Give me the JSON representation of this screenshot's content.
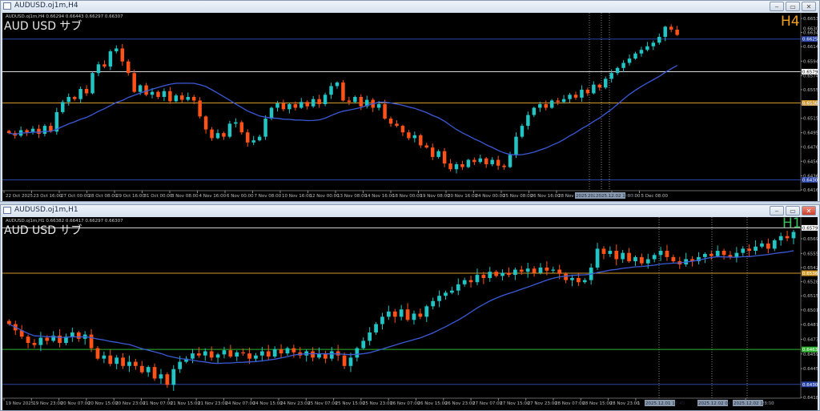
{
  "colors": {
    "bull": "#22c4c4",
    "bear": "#ff5218",
    "ma": "#3a5ad8",
    "axis": "#bfbfbf",
    "white_line": "#d8d8d8",
    "orange_line": "#d39a2a",
    "blue_line": "#2b44a8",
    "green_line": "#2fb52f"
  },
  "windows": [
    {
      "title": "AUDUSD.oj1m,H4",
      "info": "AUDUSD.oj1m,H4  0.66294 0.66443 0.66297 0.66307",
      "label": "AUD USD  サブ",
      "timeframe": "H4",
      "timeframe_color": "#f0a020",
      "buttons": {
        "minimize": "‒",
        "maximize": "▭",
        "close": "✕"
      }
    },
    {
      "title": "AUDUSD.oj1m,H1",
      "info": "AUDUSD.oj1m,H1  0.66382 0.66417 0.66297 0.66307",
      "label": "AUD USD  サブ",
      "timeframe": "H1",
      "timeframe_color": "#3fc060",
      "buttons": {
        "minimize": "‒",
        "maximize": "▭",
        "close": "✕"
      }
    }
  ],
  "chart_data": [
    {
      "type": "candlestick",
      "title": "AUDUSD.oj1m,H4",
      "ylim": [
        0.64165,
        0.66535
      ],
      "y_ticks": [
        "0.66535",
        "0.66340",
        "0.66145",
        "0.65945",
        "0.65745",
        "0.65550",
        "0.65350",
        "0.65155",
        "0.64955",
        "0.64760",
        "0.64560",
        "0.64360",
        "0.64165"
      ],
      "x_ticks": [
        "22 Oct 2025",
        "23 Oct 16:00",
        "27 Oct 00:00",
        "28 Oct 08:00",
        "29 Oct 16:00",
        "31 Oct 00:00",
        "3 Nov 08:00",
        "4 Nov 16:00",
        "6 Nov 00:00",
        "7 Nov 08:00",
        "10 Nov 16:00",
        "12 Nov 00:00",
        "13 Nov 08:00",
        "14 Nov 16:00",
        "18 Nov 00:00",
        "19 Nov 08:00",
        "20 Nov 16:00",
        "24 Nov 00:00",
        "25 Nov 08:00",
        "26 Nov 16:00",
        "28 Nov 00:00",
        "",
        "4 Dec 00:00",
        "5 Dec 08:00"
      ],
      "highlight_time_labels": [
        "2025.12.01 13:45",
        "2025.12.02 04:30",
        "2025.12.02 14:15"
      ],
      "ma_period": 20,
      "hlines": [
        {
          "price": 0.6625,
          "label": "0.66250",
          "color": "blue"
        },
        {
          "price": 0.65799,
          "label": "0.65799",
          "color": "white"
        },
        {
          "price": 0.65366,
          "label": "0.65366",
          "color": "orange"
        },
        {
          "price": 0.64304,
          "label": "0.64304",
          "color": "blue"
        }
      ],
      "current_price": "0.66307",
      "closes": [
        0.6495,
        0.64915,
        0.6499,
        0.6496,
        0.6501,
        0.6494,
        0.6505,
        0.6497,
        0.6524,
        0.6538,
        0.6545,
        0.6542,
        0.6556,
        0.655,
        0.6578,
        0.659,
        0.6587,
        0.6608,
        0.6612,
        0.6594,
        0.6578,
        0.6552,
        0.6561,
        0.6548,
        0.6552,
        0.6545,
        0.6553,
        0.6539,
        0.6547,
        0.6541,
        0.6545,
        0.654,
        0.6518,
        0.65,
        0.6488,
        0.6495,
        0.649,
        0.6508,
        0.651,
        0.6496,
        0.6482,
        0.6485,
        0.649,
        0.6515,
        0.653,
        0.6536,
        0.6528,
        0.6535,
        0.653,
        0.6538,
        0.6532,
        0.6542,
        0.6535,
        0.6548,
        0.656,
        0.6565,
        0.654,
        0.6538,
        0.6545,
        0.6532,
        0.6541,
        0.653,
        0.6535,
        0.6515,
        0.6508,
        0.6505,
        0.6496,
        0.6488,
        0.6492,
        0.6478,
        0.6475,
        0.6462,
        0.647,
        0.6453,
        0.6445,
        0.6452,
        0.6448,
        0.6458,
        0.6455,
        0.646,
        0.6452,
        0.6458,
        0.645,
        0.6448,
        0.6465,
        0.649,
        0.6505,
        0.652,
        0.653,
        0.6535,
        0.653,
        0.654,
        0.6538,
        0.6542,
        0.6548,
        0.6544,
        0.6555,
        0.655,
        0.6562,
        0.6558,
        0.657,
        0.6578,
        0.6585,
        0.6592,
        0.6598,
        0.6605,
        0.661,
        0.6615,
        0.662,
        0.6628,
        0.6642,
        0.6638,
        0.66307
      ]
    },
    {
      "type": "candlestick",
      "title": "AUDUSD.oj1m,H1",
      "ylim": [
        0.6418,
        0.65799
      ],
      "y_ticks": [
        "0.65695",
        "0.65555",
        "0.65420",
        "0.65285",
        "0.65150",
        "0.65015",
        "0.64875",
        "0.64735",
        "0.64595",
        "0.64455",
        "0.64180"
      ],
      "x_ticks": [
        "19 Nov 2025",
        "19 Nov 23:00",
        "20 Nov 07:00",
        "20 Nov 15:00",
        "20 Nov 23:00",
        "21 Nov 07:00",
        "21 Nov 15:00",
        "21 Nov 23:00",
        "24 Nov 07:00",
        "24 Nov 15:00",
        "24 Nov 23:00",
        "25 Nov 07:00",
        "25 Nov 15:00",
        "25 Nov 23:00",
        "26 Nov 07:00",
        "26 Nov 15:00",
        "26 Nov 23:00",
        "27 Nov 07:00",
        "27 Nov 15:00",
        "27 Nov 23:00",
        "28 Nov 07:00",
        "28 Nov 15:00",
        "28 Nov 23:00",
        "1",
        "",
        "",
        "",
        "2 Dec 23:00"
      ],
      "highlight_time_labels": [
        "2025.12.01 13:45",
        "2025.12.02 04:30",
        "2025.12.02 14:15"
      ],
      "ma_period": 20,
      "hlines": [
        {
          "price": 0.65799,
          "label": "0.65799",
          "color": "white"
        },
        {
          "price": 0.65366,
          "label": "0.65366",
          "color": "orange"
        },
        {
          "price": 0.64638,
          "label": "0.64638",
          "color": "green"
        },
        {
          "price": 0.64304,
          "label": "0.64304",
          "color": "blue"
        }
      ],
      "closes": [
        0.6488,
        0.6482,
        0.6476,
        0.647,
        0.6468,
        0.6475,
        0.6472,
        0.6477,
        0.647,
        0.6476,
        0.648,
        0.6474,
        0.6478,
        0.6465,
        0.6455,
        0.6458,
        0.645,
        0.6456,
        0.6448,
        0.6452,
        0.6448,
        0.6442,
        0.6447,
        0.6436,
        0.644,
        0.643,
        0.6445,
        0.6452,
        0.6455,
        0.646,
        0.6458,
        0.6462,
        0.6456,
        0.6459,
        0.6463,
        0.6457,
        0.6461,
        0.646,
        0.6455,
        0.6458,
        0.6462,
        0.6457,
        0.6464,
        0.646,
        0.6465,
        0.6461,
        0.6458,
        0.6462,
        0.6456,
        0.646,
        0.6455,
        0.6462,
        0.6458,
        0.6448,
        0.6456,
        0.6465,
        0.6472,
        0.648,
        0.6488,
        0.6495,
        0.65,
        0.6495,
        0.6502,
        0.6492,
        0.6498,
        0.6495,
        0.6505,
        0.651,
        0.6515,
        0.6518,
        0.652,
        0.6526,
        0.653,
        0.6528,
        0.6535,
        0.6532,
        0.6538,
        0.6534,
        0.6537,
        0.6535,
        0.654,
        0.6538,
        0.6541,
        0.6537,
        0.6542,
        0.6539,
        0.654,
        0.6536,
        0.653,
        0.6532,
        0.6528,
        0.653,
        0.6542,
        0.656,
        0.6555,
        0.6558,
        0.655,
        0.6556,
        0.6548,
        0.6552,
        0.6546,
        0.655,
        0.6554,
        0.6558,
        0.6552,
        0.6548,
        0.6545,
        0.655,
        0.6548,
        0.6552,
        0.6555,
        0.6553,
        0.6558,
        0.6554,
        0.6552,
        0.6556,
        0.656,
        0.6558,
        0.6562,
        0.6565,
        0.656,
        0.6568,
        0.6572,
        0.657,
        0.6576
      ]
    }
  ]
}
